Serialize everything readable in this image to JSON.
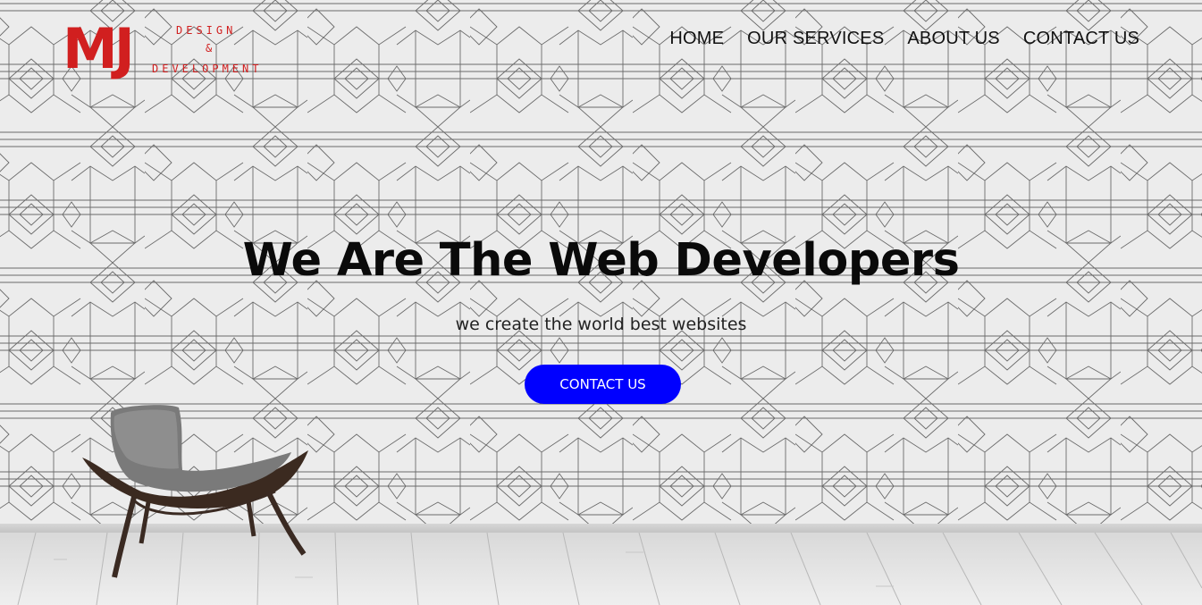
{
  "logo": {
    "mark": "MJ",
    "line1": "DESIGN",
    "line2": "&",
    "line3": "DEVELOPMENT"
  },
  "nav": {
    "items": [
      "HOME",
      "OUR SERVICES",
      "ABOUT US",
      "CONTACT US"
    ]
  },
  "hero": {
    "headline": "We Are The Web Developers",
    "subline": "we create the world best websites",
    "cta_label": "CONTACT US"
  },
  "colors": {
    "brand_red": "#d11f1f",
    "cta_blue": "#0000ff",
    "text_dark": "#111111"
  }
}
